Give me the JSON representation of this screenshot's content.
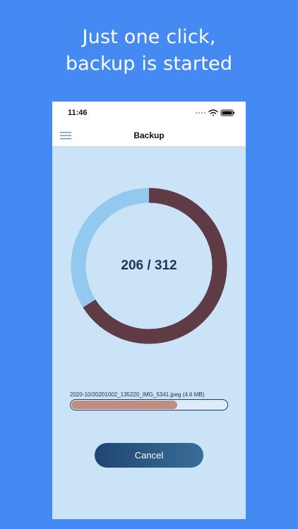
{
  "promo": {
    "line1": "Just one click,",
    "line2": "backup is started"
  },
  "statusbar": {
    "time": "11:46",
    "icons": [
      "cellular-icon",
      "wifi-icon",
      "battery-icon"
    ]
  },
  "navbar": {
    "title": "Backup",
    "menu_icon": "hamburger-menu-icon"
  },
  "backup": {
    "done": 206,
    "total": 312,
    "counter_text": "206 / 312",
    "current_file": "2020-10/20201002_135220_IMG_5341.jpeg (4.6 MB)",
    "file_progress": 0.68
  },
  "cancel_label": "Cancel",
  "colors": {
    "background": "#448af2",
    "screen": "#cbe3f6",
    "ring_done": "#5e3b45",
    "ring_remaining": "#93c9ee",
    "progress_fill": "#c08d82",
    "button": "#2a5886"
  }
}
